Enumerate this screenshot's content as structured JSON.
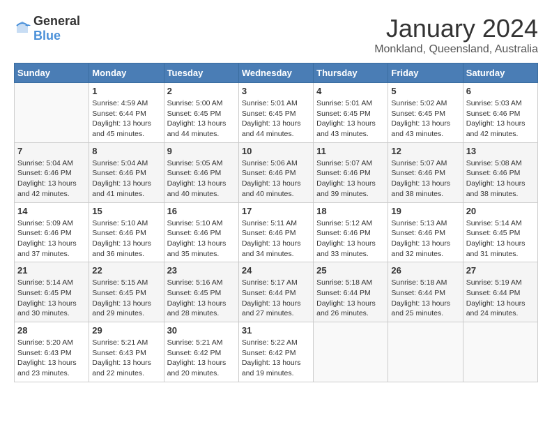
{
  "header": {
    "logo_general": "General",
    "logo_blue": "Blue",
    "month": "January 2024",
    "location": "Monkland, Queensland, Australia"
  },
  "weekdays": [
    "Sunday",
    "Monday",
    "Tuesday",
    "Wednesday",
    "Thursday",
    "Friday",
    "Saturday"
  ],
  "weeks": [
    [
      {
        "day": "",
        "info": ""
      },
      {
        "day": "1",
        "info": "Sunrise: 4:59 AM\nSunset: 6:44 PM\nDaylight: 13 hours\nand 45 minutes."
      },
      {
        "day": "2",
        "info": "Sunrise: 5:00 AM\nSunset: 6:45 PM\nDaylight: 13 hours\nand 44 minutes."
      },
      {
        "day": "3",
        "info": "Sunrise: 5:01 AM\nSunset: 6:45 PM\nDaylight: 13 hours\nand 44 minutes."
      },
      {
        "day": "4",
        "info": "Sunrise: 5:01 AM\nSunset: 6:45 PM\nDaylight: 13 hours\nand 43 minutes."
      },
      {
        "day": "5",
        "info": "Sunrise: 5:02 AM\nSunset: 6:45 PM\nDaylight: 13 hours\nand 43 minutes."
      },
      {
        "day": "6",
        "info": "Sunrise: 5:03 AM\nSunset: 6:46 PM\nDaylight: 13 hours\nand 42 minutes."
      }
    ],
    [
      {
        "day": "7",
        "info": "Sunrise: 5:04 AM\nSunset: 6:46 PM\nDaylight: 13 hours\nand 42 minutes."
      },
      {
        "day": "8",
        "info": "Sunrise: 5:04 AM\nSunset: 6:46 PM\nDaylight: 13 hours\nand 41 minutes."
      },
      {
        "day": "9",
        "info": "Sunrise: 5:05 AM\nSunset: 6:46 PM\nDaylight: 13 hours\nand 40 minutes."
      },
      {
        "day": "10",
        "info": "Sunrise: 5:06 AM\nSunset: 6:46 PM\nDaylight: 13 hours\nand 40 minutes."
      },
      {
        "day": "11",
        "info": "Sunrise: 5:07 AM\nSunset: 6:46 PM\nDaylight: 13 hours\nand 39 minutes."
      },
      {
        "day": "12",
        "info": "Sunrise: 5:07 AM\nSunset: 6:46 PM\nDaylight: 13 hours\nand 38 minutes."
      },
      {
        "day": "13",
        "info": "Sunrise: 5:08 AM\nSunset: 6:46 PM\nDaylight: 13 hours\nand 38 minutes."
      }
    ],
    [
      {
        "day": "14",
        "info": "Sunrise: 5:09 AM\nSunset: 6:46 PM\nDaylight: 13 hours\nand 37 minutes."
      },
      {
        "day": "15",
        "info": "Sunrise: 5:10 AM\nSunset: 6:46 PM\nDaylight: 13 hours\nand 36 minutes."
      },
      {
        "day": "16",
        "info": "Sunrise: 5:10 AM\nSunset: 6:46 PM\nDaylight: 13 hours\nand 35 minutes."
      },
      {
        "day": "17",
        "info": "Sunrise: 5:11 AM\nSunset: 6:46 PM\nDaylight: 13 hours\nand 34 minutes."
      },
      {
        "day": "18",
        "info": "Sunrise: 5:12 AM\nSunset: 6:46 PM\nDaylight: 13 hours\nand 33 minutes."
      },
      {
        "day": "19",
        "info": "Sunrise: 5:13 AM\nSunset: 6:46 PM\nDaylight: 13 hours\nand 32 minutes."
      },
      {
        "day": "20",
        "info": "Sunrise: 5:14 AM\nSunset: 6:45 PM\nDaylight: 13 hours\nand 31 minutes."
      }
    ],
    [
      {
        "day": "21",
        "info": "Sunrise: 5:14 AM\nSunset: 6:45 PM\nDaylight: 13 hours\nand 30 minutes."
      },
      {
        "day": "22",
        "info": "Sunrise: 5:15 AM\nSunset: 6:45 PM\nDaylight: 13 hours\nand 29 minutes."
      },
      {
        "day": "23",
        "info": "Sunrise: 5:16 AM\nSunset: 6:45 PM\nDaylight: 13 hours\nand 28 minutes."
      },
      {
        "day": "24",
        "info": "Sunrise: 5:17 AM\nSunset: 6:44 PM\nDaylight: 13 hours\nand 27 minutes."
      },
      {
        "day": "25",
        "info": "Sunrise: 5:18 AM\nSunset: 6:44 PM\nDaylight: 13 hours\nand 26 minutes."
      },
      {
        "day": "26",
        "info": "Sunrise: 5:18 AM\nSunset: 6:44 PM\nDaylight: 13 hours\nand 25 minutes."
      },
      {
        "day": "27",
        "info": "Sunrise: 5:19 AM\nSunset: 6:44 PM\nDaylight: 13 hours\nand 24 minutes."
      }
    ],
    [
      {
        "day": "28",
        "info": "Sunrise: 5:20 AM\nSunset: 6:43 PM\nDaylight: 13 hours\nand 23 minutes."
      },
      {
        "day": "29",
        "info": "Sunrise: 5:21 AM\nSunset: 6:43 PM\nDaylight: 13 hours\nand 22 minutes."
      },
      {
        "day": "30",
        "info": "Sunrise: 5:21 AM\nSunset: 6:42 PM\nDaylight: 13 hours\nand 20 minutes."
      },
      {
        "day": "31",
        "info": "Sunrise: 5:22 AM\nSunset: 6:42 PM\nDaylight: 13 hours\nand 19 minutes."
      },
      {
        "day": "",
        "info": ""
      },
      {
        "day": "",
        "info": ""
      },
      {
        "day": "",
        "info": ""
      }
    ]
  ]
}
